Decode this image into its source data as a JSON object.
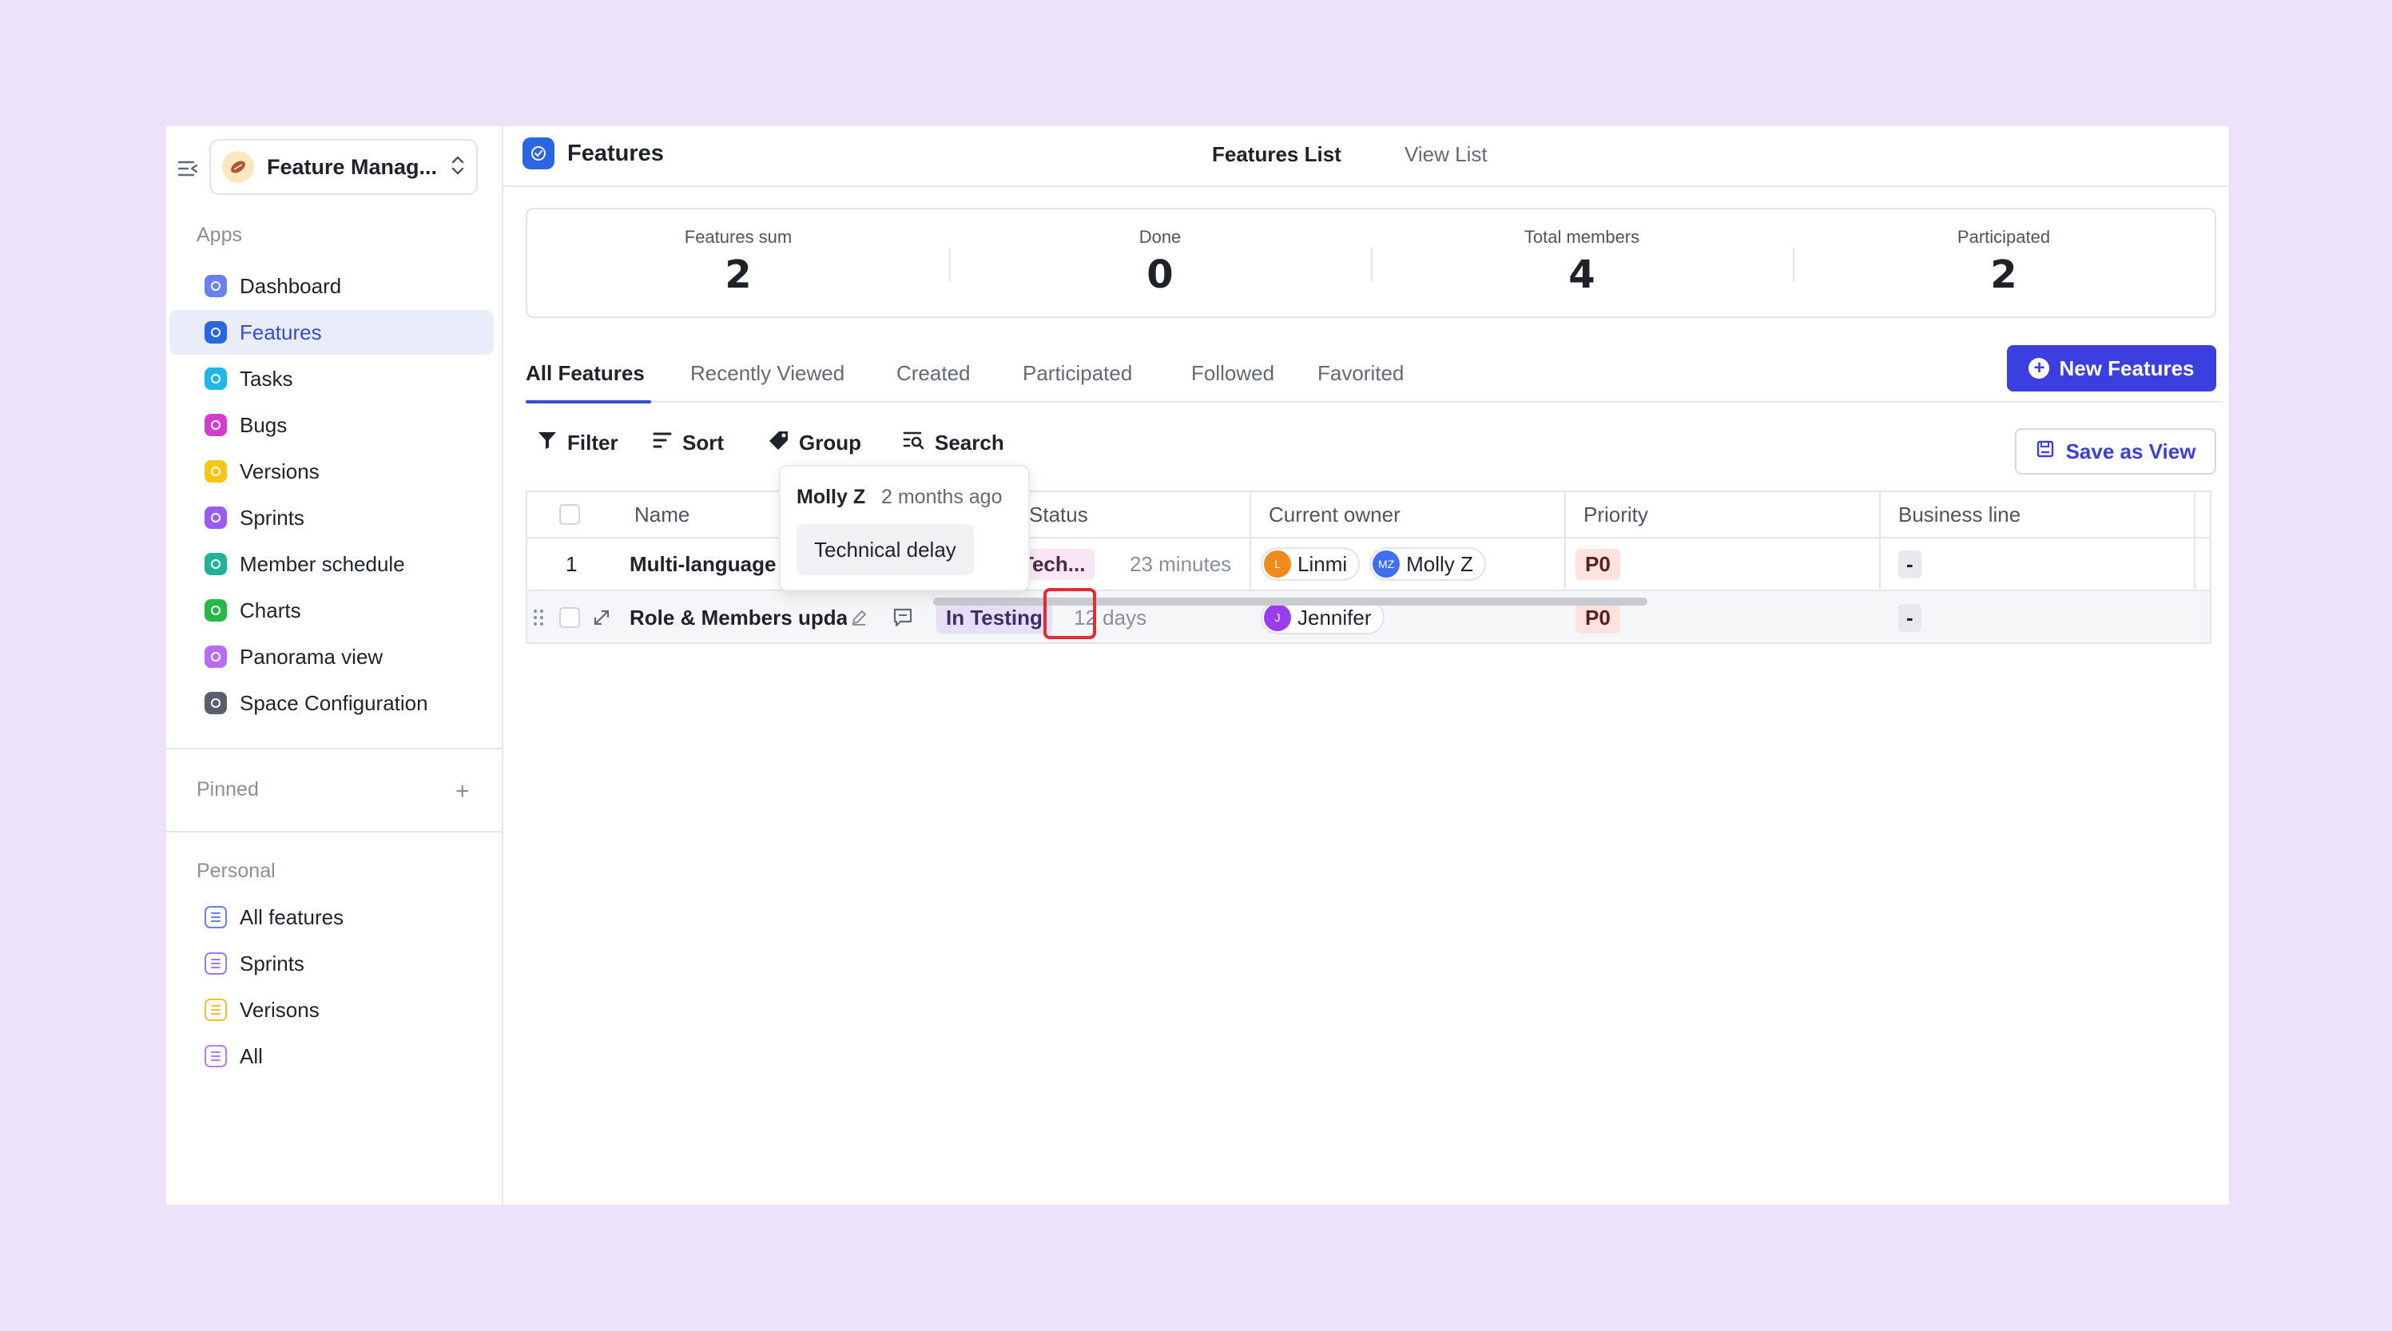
{
  "colors": {
    "accent": "#3b3fe0",
    "background": "#ece3fb",
    "highlight": "#e52a33"
  },
  "sidebar": {
    "space_name": "Feature Manag...",
    "apps_label": "Apps",
    "apps": [
      {
        "label": "Dashboard",
        "icon": "dashboard-icon",
        "color": "#6b7ff0"
      },
      {
        "label": "Features",
        "icon": "features-icon",
        "color": "#2a66e4",
        "active": true
      },
      {
        "label": "Tasks",
        "icon": "tasks-icon",
        "color": "#1fb6e8"
      },
      {
        "label": "Bugs",
        "icon": "bugs-icon",
        "color": "#d43ccf"
      },
      {
        "label": "Versions",
        "icon": "versions-icon",
        "color": "#f5c518"
      },
      {
        "label": "Sprints",
        "icon": "sprints-icon",
        "color": "#9a5cf0"
      },
      {
        "label": "Member schedule",
        "icon": "member-schedule-icon",
        "color": "#20b29a"
      },
      {
        "label": "Charts",
        "icon": "charts-icon",
        "color": "#25b94a"
      },
      {
        "label": "Panorama view",
        "icon": "panorama-icon",
        "color": "#b76cf2"
      },
      {
        "label": "Space Configuration",
        "icon": "settings-icon",
        "color": "#5a5f6b"
      }
    ],
    "pinned_label": "Pinned",
    "personal_label": "Personal",
    "personal": [
      {
        "label": "All features",
        "color": "#6b7ff0"
      },
      {
        "label": "Sprints",
        "color": "#9a7cf0"
      },
      {
        "label": "Verisons",
        "color": "#f0c030"
      },
      {
        "label": "All",
        "color": "#b97cf0"
      }
    ]
  },
  "header": {
    "title": "Features",
    "tabs": [
      "Features List",
      "View List"
    ]
  },
  "stats": [
    {
      "label": "Features sum",
      "value": "2"
    },
    {
      "label": "Done",
      "value": "0"
    },
    {
      "label": "Total members",
      "value": "4"
    },
    {
      "label": "Participated",
      "value": "2"
    }
  ],
  "view_tabs": [
    "All Features",
    "Recently Viewed",
    "Created",
    "Participated",
    "Followed",
    "Favorited"
  ],
  "new_button": "New Features",
  "toolbar": {
    "filter": "Filter",
    "sort": "Sort",
    "group": "Group",
    "search": "Search",
    "save_view": "Save as View"
  },
  "table": {
    "columns": [
      "Name",
      "Status",
      "Current owner",
      "Priority",
      "Business line"
    ],
    "rows": [
      {
        "index": "1",
        "name": "Multi-language",
        "status": "Tech...",
        "time": "23 minutes",
        "owners": [
          "Linmi",
          "Molly Z"
        ],
        "priority": "P0",
        "business_line": "-"
      },
      {
        "name": "Role & Members updat",
        "status": "In Testing",
        "time": "12 days",
        "owners": [
          "Jennifer"
        ],
        "priority": "P0",
        "business_line": "-"
      }
    ]
  },
  "comment_popover": {
    "author": "Molly Z",
    "time": "2 months ago",
    "text": "Technical delay"
  }
}
